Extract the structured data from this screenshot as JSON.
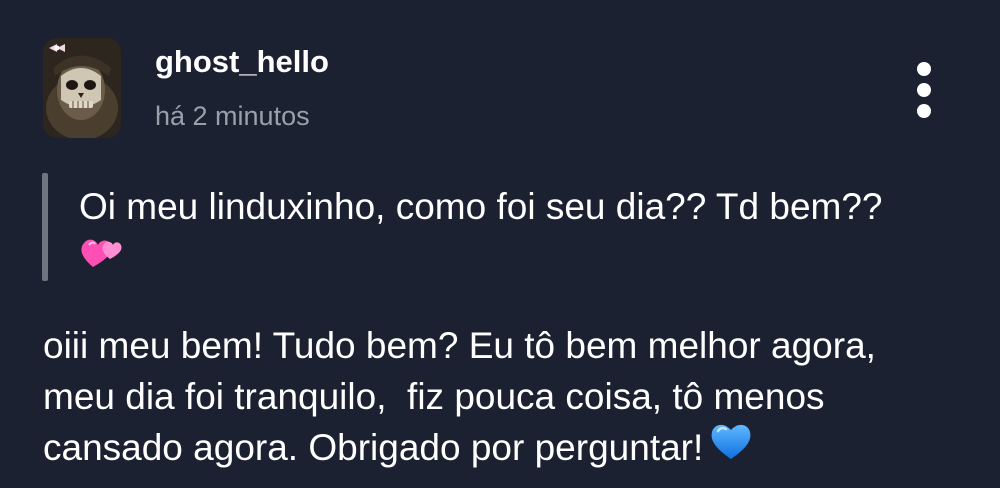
{
  "post": {
    "username": "ghost_hello",
    "timestamp": "há 2 minutos",
    "avatar_icon": "masked-soldier-avatar",
    "menu_icon": "more-vertical-icon"
  },
  "quote": {
    "text": "Oi meu linduxinho, como foi seu dia?? Td bem??",
    "emoji_icon": "two-hearts-emoji"
  },
  "reply": {
    "lines": [
      "oiii meu bem! Tudo bem? Eu tô bem melhor agora,",
      "meu dia foi tranquilo,  fiz pouca coisa, tô menos",
      "cansado agora. Obrigado por perguntar!"
    ],
    "emoji_icon": "blue-heart-emoji"
  },
  "colors": {
    "background": "#1b2130",
    "text": "#ffffff",
    "muted": "#9aa0aa",
    "quote_bar": "#6e7480",
    "heart_pink": "#ff4fb4",
    "heart_blue": "#1e8cff"
  }
}
